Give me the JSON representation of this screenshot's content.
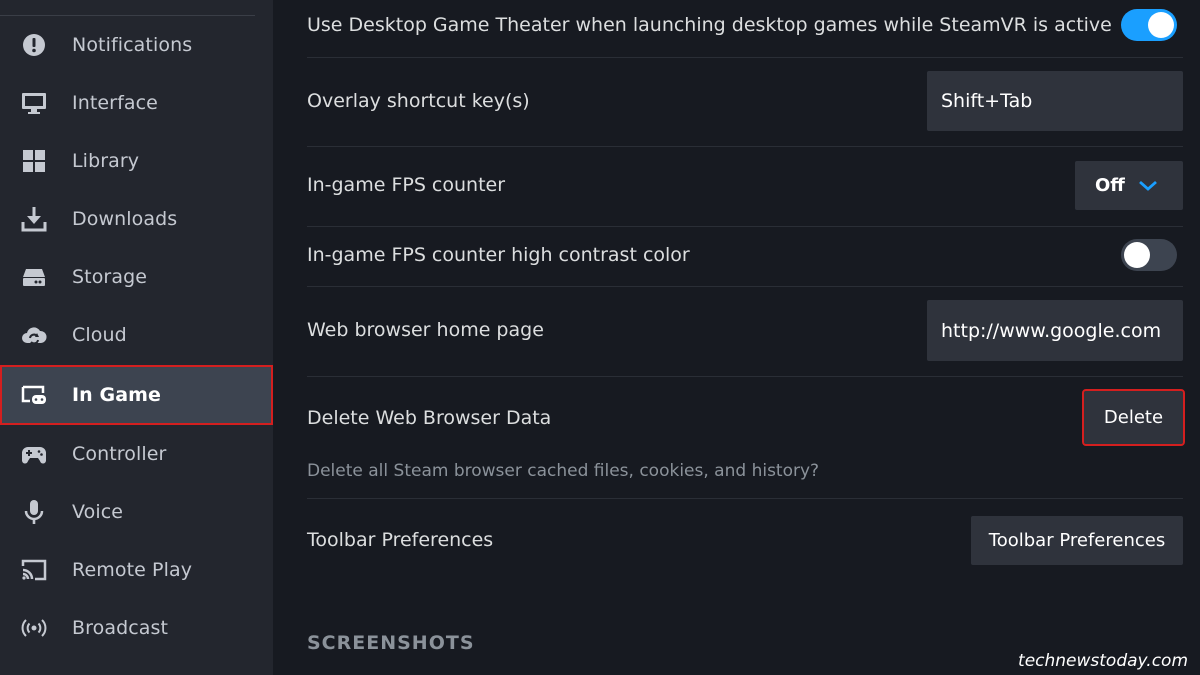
{
  "sidebar": {
    "items": [
      {
        "label": "Notifications",
        "icon": "notification-icon"
      },
      {
        "label": "Interface",
        "icon": "monitor-icon"
      },
      {
        "label": "Library",
        "icon": "grid-icon"
      },
      {
        "label": "Downloads",
        "icon": "download-icon"
      },
      {
        "label": "Storage",
        "icon": "drive-icon"
      },
      {
        "label": "Cloud",
        "icon": "cloud-icon"
      },
      {
        "label": "In Game",
        "icon": "ingame-icon",
        "active": true
      },
      {
        "label": "Controller",
        "icon": "gamepad-icon"
      },
      {
        "label": "Voice",
        "icon": "microphone-icon"
      },
      {
        "label": "Remote Play",
        "icon": "cast-icon"
      },
      {
        "label": "Broadcast",
        "icon": "broadcast-icon"
      }
    ]
  },
  "settings": {
    "desktop_theater": {
      "label": "Use Desktop Game Theater when launching desktop games while SteamVR is active",
      "enabled": true
    },
    "overlay_shortcut": {
      "label": "Overlay shortcut key(s)",
      "value": "Shift+Tab"
    },
    "fps_counter": {
      "label": "In-game FPS counter",
      "value": "Off"
    },
    "fps_high_contrast": {
      "label": "In-game FPS counter high contrast color",
      "enabled": false
    },
    "home_page": {
      "label": "Web browser home page",
      "value": "http://www.google.com"
    },
    "delete_browser_data": {
      "label": "Delete Web Browser Data",
      "button": "Delete",
      "description": "Delete all Steam browser cached files, cookies, and history?"
    },
    "toolbar_prefs": {
      "label": "Toolbar Preferences",
      "button": "Toolbar Preferences"
    }
  },
  "sections": {
    "screenshots": "SCREENSHOTS"
  },
  "watermark": "technewstoday.com",
  "colors": {
    "accent": "#1a9fff",
    "highlight": "#d41f1f",
    "sidebar_bg": "#23262e",
    "main_bg": "#171a21"
  }
}
